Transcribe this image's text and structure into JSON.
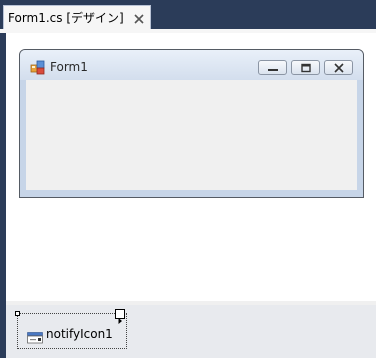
{
  "document_tab": {
    "title": "Form1.cs [デザイン]",
    "close_icon": "close-icon"
  },
  "form": {
    "title": "Form1",
    "icon": "form-app-icon",
    "minimize_icon": "minimize-icon",
    "maximize_icon": "maximize-icon",
    "close_icon": "close-icon"
  },
  "component_tray": {
    "items": [
      {
        "label": "notifyIcon1",
        "icon": "notify-icon"
      }
    ]
  },
  "colors": {
    "ide_background": "#2b3c59",
    "tab_background": "#f6f6f6",
    "form_border": "#555b64",
    "form_client": "#f0f0f0",
    "tray_background": "#e8eaee"
  }
}
